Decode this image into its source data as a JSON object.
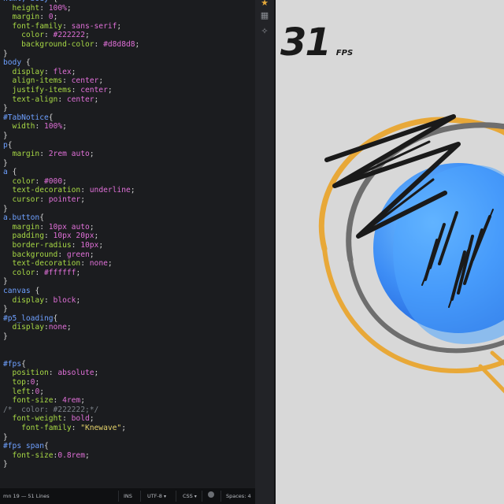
{
  "editor": {
    "language": "CSS",
    "lines": [
      [
        [
          "sel",
          "html, body "
        ],
        [
          "brace",
          "{"
        ]
      ],
      [
        [
          "prop",
          "  height"
        ],
        [
          "brace",
          ": "
        ],
        [
          "num",
          "100%"
        ],
        [
          "brace",
          ";"
        ]
      ],
      [
        [
          "prop",
          "  margin"
        ],
        [
          "brace",
          ": "
        ],
        [
          "num",
          "0"
        ],
        [
          "brace",
          ";"
        ]
      ],
      [
        [
          "prop",
          "  font-family"
        ],
        [
          "brace",
          ": "
        ],
        [
          "val",
          "sans-serif"
        ],
        [
          "brace",
          ";"
        ]
      ],
      [
        [
          "prop",
          "    color"
        ],
        [
          "brace",
          ": "
        ],
        [
          "num",
          "#222222"
        ],
        [
          "brace",
          ";"
        ]
      ],
      [
        [
          "prop",
          "    background-color"
        ],
        [
          "brace",
          ": "
        ],
        [
          "num",
          "#d8d8d8"
        ],
        [
          "brace",
          ";"
        ]
      ],
      [
        [
          "brace",
          "}"
        ]
      ],
      [
        [
          "sel",
          "body "
        ],
        [
          "brace",
          "{"
        ]
      ],
      [
        [
          "prop",
          "  display"
        ],
        [
          "brace",
          ": "
        ],
        [
          "val",
          "flex"
        ],
        [
          "brace",
          ";"
        ]
      ],
      [
        [
          "prop",
          "  align-items"
        ],
        [
          "brace",
          ": "
        ],
        [
          "val",
          "center"
        ],
        [
          "brace",
          ";"
        ]
      ],
      [
        [
          "prop",
          "  justify-items"
        ],
        [
          "brace",
          ": "
        ],
        [
          "val",
          "center"
        ],
        [
          "brace",
          ";"
        ]
      ],
      [
        [
          "prop",
          "  text-align"
        ],
        [
          "brace",
          ": "
        ],
        [
          "val",
          "center"
        ],
        [
          "brace",
          ";"
        ]
      ],
      [
        [
          "brace",
          "}"
        ]
      ],
      [
        [
          "sel",
          "#TabNotice"
        ],
        [
          "brace",
          "{"
        ]
      ],
      [
        [
          "prop",
          "  width"
        ],
        [
          "brace",
          ": "
        ],
        [
          "num",
          "100%"
        ],
        [
          "brace",
          ";"
        ]
      ],
      [
        [
          "brace",
          "}"
        ]
      ],
      [
        [
          "sel",
          "p"
        ],
        [
          "brace",
          "{"
        ]
      ],
      [
        [
          "prop",
          "  margin"
        ],
        [
          "brace",
          ": "
        ],
        [
          "num",
          "2rem"
        ],
        [
          "val",
          " auto"
        ],
        [
          "brace",
          ";"
        ]
      ],
      [
        [
          "brace",
          "}"
        ]
      ],
      [
        [
          "sel",
          "a "
        ],
        [
          "brace",
          "{"
        ]
      ],
      [
        [
          "prop",
          "  color"
        ],
        [
          "brace",
          ": "
        ],
        [
          "num",
          "#000"
        ],
        [
          "brace",
          ";"
        ]
      ],
      [
        [
          "prop",
          "  text-decoration"
        ],
        [
          "brace",
          ": "
        ],
        [
          "val",
          "underline"
        ],
        [
          "brace",
          ";"
        ]
      ],
      [
        [
          "prop",
          "  cursor"
        ],
        [
          "brace",
          ": "
        ],
        [
          "val",
          "pointer"
        ],
        [
          "brace",
          ";"
        ]
      ],
      [
        [
          "brace",
          "}"
        ]
      ],
      [
        [
          "sel",
          "a.button"
        ],
        [
          "brace",
          "{"
        ]
      ],
      [
        [
          "prop",
          "  margin"
        ],
        [
          "brace",
          ": "
        ],
        [
          "num",
          "10px"
        ],
        [
          "val",
          " auto"
        ],
        [
          "brace",
          ";"
        ]
      ],
      [
        [
          "prop",
          "  padding"
        ],
        [
          "brace",
          ": "
        ],
        [
          "num",
          "10px 20px"
        ],
        [
          "brace",
          ";"
        ]
      ],
      [
        [
          "prop",
          "  border-radius"
        ],
        [
          "brace",
          ": "
        ],
        [
          "num",
          "10px"
        ],
        [
          "brace",
          ";"
        ]
      ],
      [
        [
          "prop",
          "  background"
        ],
        [
          "brace",
          ": "
        ],
        [
          "val",
          "green"
        ],
        [
          "brace",
          ";"
        ]
      ],
      [
        [
          "prop",
          "  text-decoration"
        ],
        [
          "brace",
          ": "
        ],
        [
          "val",
          "none"
        ],
        [
          "brace",
          ";"
        ]
      ],
      [
        [
          "prop",
          "  color"
        ],
        [
          "brace",
          ": "
        ],
        [
          "num",
          "#ffffff"
        ],
        [
          "brace",
          ";"
        ]
      ],
      [
        [
          "brace",
          "}"
        ]
      ],
      [
        [
          "sel",
          "canvas "
        ],
        [
          "brace",
          "{"
        ]
      ],
      [
        [
          "prop",
          "  display"
        ],
        [
          "brace",
          ": "
        ],
        [
          "val",
          "block"
        ],
        [
          "brace",
          ";"
        ]
      ],
      [
        [
          "brace",
          "}"
        ]
      ],
      [
        [
          "sel",
          "#p5_loading"
        ],
        [
          "brace",
          "{"
        ]
      ],
      [
        [
          "prop",
          "  display"
        ],
        [
          "brace",
          ":"
        ],
        [
          "val",
          "none"
        ],
        [
          "brace",
          ";"
        ]
      ],
      [
        [
          "brace",
          "}"
        ]
      ],
      [
        [
          "brace",
          " "
        ]
      ],
      [
        [
          "brace",
          " "
        ]
      ],
      [
        [
          "sel",
          "#fps"
        ],
        [
          "brace",
          "{"
        ]
      ],
      [
        [
          "prop",
          "  position"
        ],
        [
          "brace",
          ": "
        ],
        [
          "val",
          "absolute"
        ],
        [
          "brace",
          ";"
        ]
      ],
      [
        [
          "prop",
          "  top"
        ],
        [
          "brace",
          ":"
        ],
        [
          "num",
          "0"
        ],
        [
          "brace",
          ";"
        ]
      ],
      [
        [
          "prop",
          "  left"
        ],
        [
          "brace",
          ":"
        ],
        [
          "num",
          "0"
        ],
        [
          "brace",
          ";"
        ]
      ],
      [
        [
          "prop",
          "  font-size"
        ],
        [
          "brace",
          ": "
        ],
        [
          "num",
          "4rem"
        ],
        [
          "brace",
          ";"
        ]
      ],
      [
        [
          "cmt",
          "/*  color: #222222;*/"
        ]
      ],
      [
        [
          "prop",
          "  font-weight"
        ],
        [
          "brace",
          ": "
        ],
        [
          "val",
          "bold"
        ],
        [
          "brace",
          ";"
        ]
      ],
      [
        [
          "prop",
          "    font-family"
        ],
        [
          "brace",
          ": "
        ],
        [
          "str",
          "\"Knewave\""
        ],
        [
          "brace",
          ";"
        ]
      ],
      [
        [
          "brace",
          "}"
        ]
      ],
      [
        [
          "sel",
          "#fps span"
        ],
        [
          "brace",
          "{"
        ]
      ],
      [
        [
          "prop",
          "  font-size"
        ],
        [
          "brace",
          ":"
        ],
        [
          "num",
          "0.8rem"
        ],
        [
          "brace",
          ";"
        ]
      ],
      [
        [
          "brace",
          "}"
        ]
      ]
    ]
  },
  "statusbar": {
    "position": "mn 19 — 51 Lines",
    "mode": "INS",
    "encoding": "UTF-8",
    "language": "CSS",
    "spaces": "Spaces: 4"
  },
  "gutter": {
    "icons": [
      "star-icon",
      "briefcase-icon",
      "magic-wand-icon"
    ],
    "glyphs": [
      "★",
      "▦",
      "✧"
    ]
  },
  "preview": {
    "fps_value": "31",
    "fps_unit": "FPS",
    "colors": {
      "background": "#d8d8d8",
      "orange_ring": "#e8a838",
      "gray_ring": "#737373",
      "blue_light": "#5bb3ff",
      "blue_dark": "#1f6fe0",
      "stroke": "#1a1a1a"
    }
  }
}
